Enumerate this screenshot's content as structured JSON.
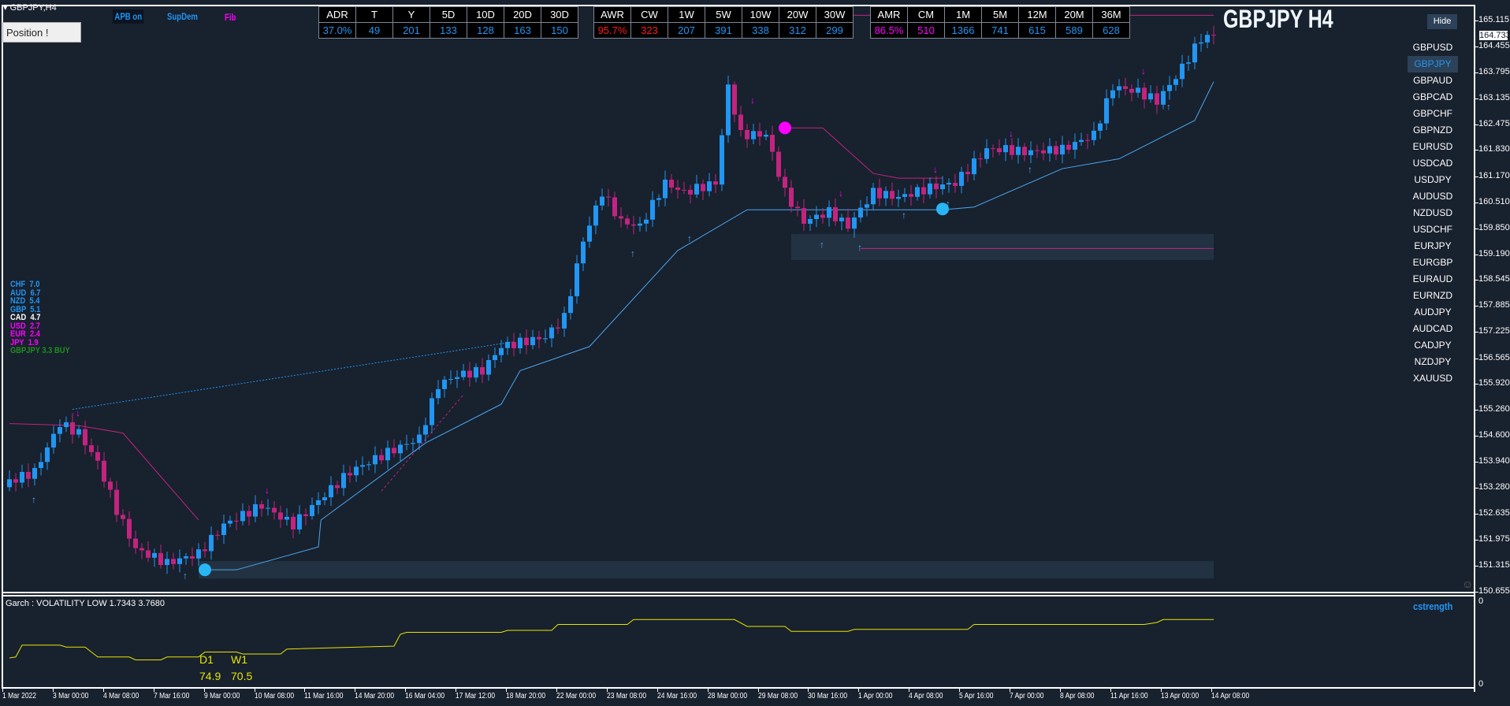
{
  "header": {
    "symbol_label": "GBPJPY,H4",
    "position_button": "Position !",
    "apb": "APB on",
    "supdem": "SupDem",
    "fib": "Fib",
    "title": "GBPJPY H4",
    "hide_button": "Hide"
  },
  "colors": {
    "bull": "#2196f3",
    "bear": "#c2247f",
    "bg": "#18212e",
    "zone": "#223242",
    "trail": "#4aa8f0",
    "magenta": "#c2247f",
    "garch": "#e6e600"
  },
  "tables": [
    {
      "headers": [
        "ADR",
        "T",
        "Y",
        "5D",
        "10D",
        "20D",
        "30D"
      ],
      "values": [
        "37.0%",
        "49",
        "201",
        "133",
        "128",
        "163",
        "150"
      ],
      "value_colors": [
        "#2196f3",
        "#2196f3",
        "#2196f3",
        "#2196f3",
        "#2196f3",
        "#2196f3",
        "#2196f3"
      ]
    },
    {
      "headers": [
        "AWR",
        "CW",
        "1W",
        "5W",
        "10W",
        "20W",
        "30W"
      ],
      "values": [
        "95.7%",
        "323",
        "207",
        "391",
        "338",
        "312",
        "299"
      ],
      "value_colors": [
        "#ff1a1a",
        "#ff1a1a",
        "#2196f3",
        "#2196f3",
        "#2196f3",
        "#2196f3",
        "#2196f3"
      ]
    },
    {
      "headers": [
        "AMR",
        "CM",
        "1M",
        "5M",
        "12M",
        "20M",
        "36M"
      ],
      "values": [
        "86.5%",
        "510",
        "1366",
        "741",
        "615",
        "589",
        "628"
      ],
      "value_colors": [
        "#ff00ff",
        "#ff00ff",
        "#2196f3",
        "#2196f3",
        "#2196f3",
        "#2196f3",
        "#2196f3"
      ]
    }
  ],
  "symbols": [
    "GBPUSD",
    "GBPJPY",
    "GBPAUD",
    "GBPCAD",
    "GBPCHF",
    "GBPNZD",
    "EURUSD",
    "USDCAD",
    "USDJPY",
    "AUDUSD",
    "NZDUSD",
    "USDCHF",
    "EURJPY",
    "EURGBP",
    "EURAUD",
    "EURNZD",
    "AUDJPY",
    "AUDCAD",
    "CADJPY",
    "NZDJPY",
    "XAUUSD"
  ],
  "selected_symbol": "GBPJPY",
  "currency_strength": [
    {
      "cur": "CHF",
      "val": "7.0",
      "color": "#2196f3"
    },
    {
      "cur": "AUD",
      "val": "6.7",
      "color": "#2196f3"
    },
    {
      "cur": "NZD",
      "val": "5.4",
      "color": "#2196f3"
    },
    {
      "cur": "GBP",
      "val": "5.1",
      "color": "#2196f3"
    },
    {
      "cur": "CAD",
      "val": "4.7",
      "color": "#ffffff"
    },
    {
      "cur": "USD",
      "val": "2.7",
      "color": "#ff00ff"
    },
    {
      "cur": "EUR",
      "val": "2.4",
      "color": "#ff00ff"
    },
    {
      "cur": "JPY",
      "val": "1.9",
      "color": "#ff00ff"
    }
  ],
  "signal": {
    "text": "GBPJPY 3.3 BUY",
    "color": "#1f8f1f"
  },
  "indicator": {
    "garch_label": "Garch : VOLATILITY LOW 1.7343 3.7680",
    "d1_label": "D1",
    "w1_label": "W1",
    "d1_value": "74.9",
    "w1_value": "70.5",
    "cstrength": "cstrength",
    "axis_top": "0",
    "axis_bottom": "0"
  },
  "current_price": "164.733",
  "chart_data": {
    "type": "candlestick",
    "price_labels": [
      "165.115",
      "164.455",
      "163.795",
      "163.135",
      "162.475",
      "161.830",
      "161.170",
      "160.510",
      "159.850",
      "159.190",
      "158.545",
      "157.885",
      "157.225",
      "156.565",
      "155.920",
      "155.260",
      "154.600",
      "153.940",
      "153.280",
      "152.635",
      "151.975",
      "151.315",
      "150.655"
    ],
    "ylim": [
      150.655,
      165.115
    ],
    "time_labels": [
      "1 Mar 2022",
      "3 Mar 00:00",
      "4 Mar 08:00",
      "7 Mar 16:00",
      "9 Mar 00:00",
      "10 Mar 08:00",
      "11 Mar 16:00",
      "14 Mar 20:00",
      "16 Mar 04:00",
      "17 Mar 12:00",
      "18 Mar 20:00",
      "22 Mar 00:00",
      "23 Mar 08:00",
      "24 Mar 16:00",
      "28 Mar 00:00",
      "29 Mar 08:00",
      "30 Mar 16:00",
      "1 Apr 00:00",
      "4 Apr 08:00",
      "5 Apr 16:00",
      "7 Apr 00:00",
      "8 Apr 08:00",
      "11 Apr 16:00",
      "13 Apr 00:00",
      "14 Apr 08:00"
    ],
    "candle_count": 192,
    "close_anchors": [
      [
        0,
        153.3
      ],
      [
        1,
        153.45
      ],
      [
        5,
        153.69
      ],
      [
        9,
        154.91
      ],
      [
        12,
        154.67
      ],
      [
        15,
        153.93
      ],
      [
        18,
        152.72
      ],
      [
        21,
        151.74
      ],
      [
        26,
        151.38
      ],
      [
        31,
        151.62
      ],
      [
        35,
        152.35
      ],
      [
        41,
        152.84
      ],
      [
        46,
        152.35
      ],
      [
        50,
        152.96
      ],
      [
        55,
        153.69
      ],
      [
        61,
        154.18
      ],
      [
        66,
        154.54
      ],
      [
        69,
        155.88
      ],
      [
        72,
        156.13
      ],
      [
        76,
        156.25
      ],
      [
        79,
        156.86
      ],
      [
        86,
        157.1
      ],
      [
        89,
        157.59
      ],
      [
        92,
        159.54
      ],
      [
        95,
        160.76
      ],
      [
        98,
        160.02
      ],
      [
        101,
        159.9
      ],
      [
        105,
        161.0
      ],
      [
        108,
        160.76
      ],
      [
        113,
        161.0
      ],
      [
        115,
        163.43
      ],
      [
        117,
        162.22
      ],
      [
        121,
        162.22
      ],
      [
        124,
        160.76
      ],
      [
        127,
        160.02
      ],
      [
        131,
        160.27
      ],
      [
        134,
        159.9
      ],
      [
        138,
        160.76
      ],
      [
        142,
        160.63
      ],
      [
        147,
        160.88
      ],
      [
        151,
        161.0
      ],
      [
        156,
        161.85
      ],
      [
        159,
        161.85
      ],
      [
        162,
        161.78
      ],
      [
        168,
        161.85
      ],
      [
        173,
        162.22
      ],
      [
        176,
        163.43
      ],
      [
        180,
        163.31
      ],
      [
        183,
        163.07
      ],
      [
        186,
        163.68
      ],
      [
        190,
        164.65
      ],
      [
        192,
        164.73
      ]
    ],
    "trail_line": [
      [
        32,
        151.21
      ],
      [
        37,
        151.21
      ],
      [
        50,
        151.79
      ],
      [
        50.4,
        152.47
      ],
      [
        67,
        154.42
      ],
      [
        79,
        155.4
      ],
      [
        82,
        156.25
      ],
      [
        93,
        156.86
      ],
      [
        107,
        159.29
      ],
      [
        118,
        160.32
      ],
      [
        149,
        160.32
      ],
      [
        154,
        160.39
      ],
      [
        168,
        161.36
      ],
      [
        177,
        161.61
      ],
      [
        189,
        162.58
      ],
      [
        192,
        163.56
      ]
    ],
    "magenta_lines": [
      [
        [
          1,
          154.91
        ],
        [
          12,
          154.86
        ],
        [
          19,
          154.67
        ],
        [
          31,
          152.47
        ]
      ],
      [
        [
          123,
          162.39
        ],
        [
          130,
          162.39
        ],
        [
          138,
          161.24
        ],
        [
          142,
          161.12
        ],
        [
          149,
          161.12
        ]
      ],
      [
        [
          127,
          165.24
        ],
        [
          192,
          165.24
        ]
      ],
      [
        [
          136,
          159.34
        ],
        [
          192,
          159.34
        ]
      ]
    ],
    "dotted_line": [
      [
        11,
        155.27
      ],
      [
        81,
        156.98
      ]
    ],
    "dashed_line": [
      [
        60,
        153.2
      ],
      [
        73,
        155.64
      ]
    ],
    "zones": [
      [
        31,
        192,
        151.43,
        150.99
      ],
      [
        125,
        192,
        159.71,
        159.05
      ]
    ],
    "up_arrows": [
      [
        5,
        153.01
      ],
      [
        29,
        151.08
      ],
      [
        100,
        159.24
      ],
      [
        109,
        159.62
      ],
      [
        130,
        159.46
      ],
      [
        136,
        159.39
      ],
      [
        143,
        160.2
      ],
      [
        150,
        160.49
      ],
      [
        163,
        161.36
      ],
      [
        185,
        162.95
      ]
    ],
    "down_arrows": [
      [
        12,
        155.2
      ],
      [
        42,
        153.25
      ],
      [
        97,
        160.51
      ],
      [
        119,
        163.12
      ],
      [
        133,
        160.76
      ],
      [
        148,
        161.36
      ],
      [
        160,
        162.27
      ],
      [
        181,
        163.85
      ]
    ],
    "circles": [
      [
        124,
        162.39,
        "#ff00ff"
      ],
      [
        32,
        151.21,
        "#29b6f6"
      ],
      [
        149,
        160.34,
        "#29b6f6"
      ]
    ],
    "garch_series": [
      [
        1,
        16
      ],
      [
        2,
        17
      ],
      [
        3,
        29
      ],
      [
        9,
        29
      ],
      [
        10,
        27
      ],
      [
        13,
        27
      ],
      [
        15,
        17
      ],
      [
        20,
        17
      ],
      [
        21,
        14
      ],
      [
        25,
        14
      ],
      [
        26,
        17
      ],
      [
        31,
        17
      ],
      [
        32,
        22
      ],
      [
        37,
        22
      ],
      [
        38,
        20
      ],
      [
        44,
        20
      ],
      [
        45,
        25
      ],
      [
        62,
        28
      ],
      [
        63,
        40
      ],
      [
        64,
        42
      ],
      [
        79,
        42
      ],
      [
        80,
        44
      ],
      [
        87,
        44
      ],
      [
        88,
        50
      ],
      [
        99,
        50
      ],
      [
        100,
        55
      ],
      [
        116,
        55
      ],
      [
        118,
        48
      ],
      [
        124,
        48
      ],
      [
        125,
        43
      ],
      [
        134,
        43
      ],
      [
        135,
        45
      ],
      [
        153,
        45
      ],
      [
        154,
        50
      ],
      [
        181,
        50
      ],
      [
        183,
        52
      ],
      [
        184,
        55
      ],
      [
        192,
        55
      ]
    ]
  }
}
